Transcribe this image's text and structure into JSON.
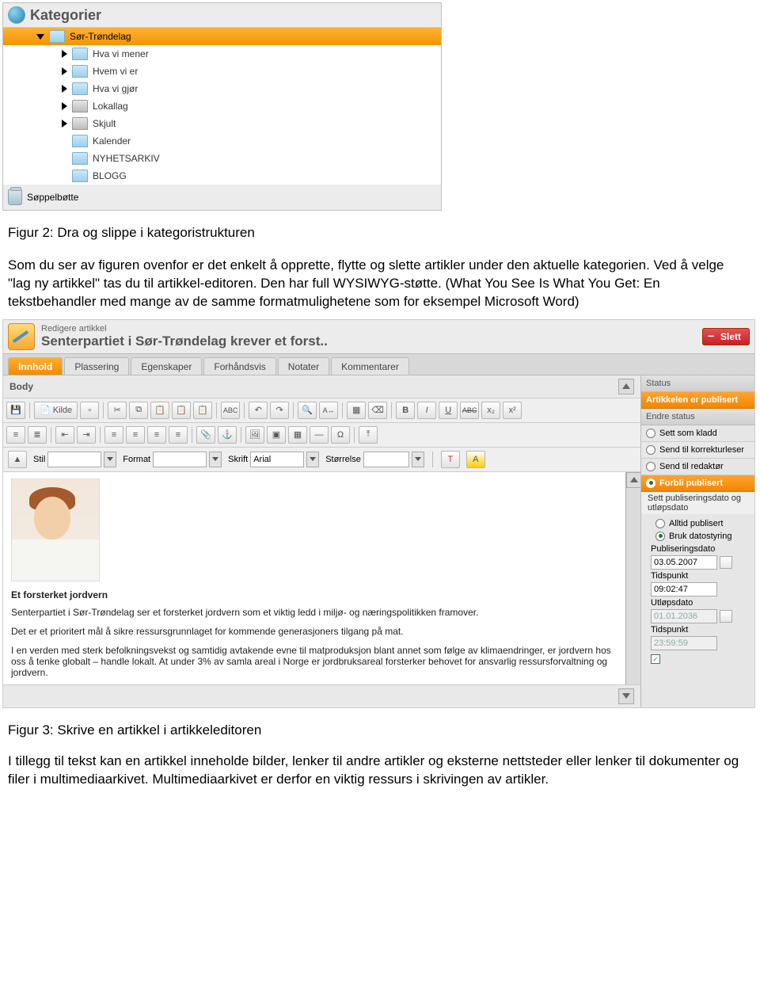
{
  "categories_panel": {
    "title": "Kategorier",
    "root": "Sør-Trøndelag",
    "items": [
      {
        "label": "Hva vi mener",
        "folder": "blue",
        "arrow": true
      },
      {
        "label": "Hvem vi er",
        "folder": "blue",
        "arrow": true
      },
      {
        "label": "Hva vi gjør",
        "folder": "blue",
        "arrow": true
      },
      {
        "label": "Lokallag",
        "folder": "gray",
        "arrow": true
      },
      {
        "label": "Skjult",
        "folder": "gray",
        "arrow": true
      },
      {
        "label": "Kalender",
        "folder": "blue",
        "arrow": false
      },
      {
        "label": "NYHETSARKIV",
        "folder": "blue",
        "arrow": false
      },
      {
        "label": "BLOGG",
        "folder": "blue",
        "arrow": false
      }
    ],
    "trash": "Søppelbøtte"
  },
  "caption2": "Figur 2: Dra og slippe i kategoristrukturen",
  "body_text": "Som du ser av figuren ovenfor er det enkelt å opprette, flytte og slette artikler under den aktuelle kategorien. Ved å velge \"lag ny artikkel\" tas du til artikkel-editoren. Den har full WYSIWYG-støtte. (What You See Is What You Get: En tekstbehandler med mange av de samme formatmulighetene som for eksempel Microsoft Word)",
  "editor": {
    "subtitle": "Redigere artikkel",
    "title": "Senterpartiet i Sør-Trøndelag krever et forst..",
    "delete_label": "Slett",
    "tabs": [
      "Innhold",
      "Plassering",
      "Egenskaper",
      "Forhåndsvis",
      "Notater",
      "Kommentarer"
    ],
    "body_label": "Body",
    "kilde_label": "Kilde",
    "style_label": "Stil",
    "format_label": "Format",
    "font_label": "Skrift",
    "font_value": "Arial",
    "size_label": "Størrelse",
    "article": {
      "heading": "Et forsterket jordvern",
      "p1": "Senterpartiet i Sør-Trøndelag ser et forsterket jordvern som et viktig ledd i miljø- og næringspolitikken framover.",
      "p2": "Det er et prioritert mål å sikre ressursgrunnlaget for kommende generasjoners tilgang på mat.",
      "p3": "I en verden med sterk befolkningsvekst og samtidig avtakende evne til matproduksjon blant annet som følge av klimaendringer, er jordvern hos oss å tenke globalt – handle lokalt. At under 3% av samla areal i Norge er jordbruksareal forsterker behovet for ansvarlig ressursforvaltning og jordvern."
    },
    "side": {
      "status_h": "Status",
      "pub_banner": "Artikkelen er publisert",
      "change_h": "Endre status",
      "r1": "Sett som kladd",
      "r2": "Send til korrekturleser",
      "r3": "Send til redaktør",
      "r4_title": "Forbli publisert",
      "r4_sub": "Sett publiseringsdato og utløpsdato",
      "opt1": "Alltid publisert",
      "opt2": "Bruk datostyring",
      "pubdate_l": "Publiseringsdato",
      "pubdate_v": "03.05.2007",
      "pubtime_l": "Tidspunkt",
      "pubtime_v": "09:02:47",
      "expdate_l": "Utløpsdato",
      "expdate_v": "01.01.2036",
      "exptime_l": "Tidspunkt",
      "exptime_v": "23:59:59"
    }
  },
  "caption3": "Figur 3: Skrive en artikkel i artikkeleditoren",
  "body_text2": "I tillegg til tekst kan en artikkel inneholde bilder, lenker til andre artikler og eksterne nettsteder eller lenker til dokumenter og filer i multimediaarkivet. Multimediaarkivet er derfor en viktig ressurs i skrivingen av artikler."
}
